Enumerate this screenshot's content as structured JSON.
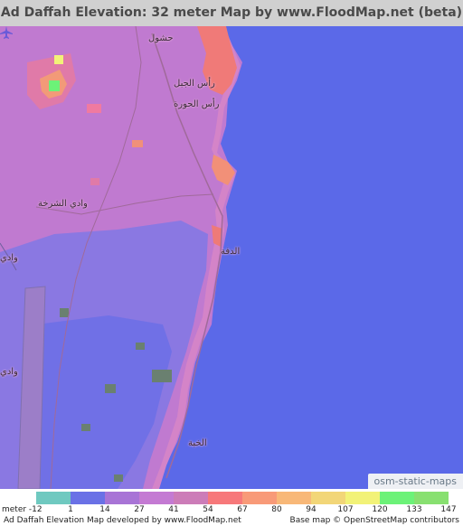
{
  "title": "Ad Daffah Elevation: 32 meter Map by www.FloodMap.net (beta)",
  "map": {
    "places": [
      {
        "name": "place-hashul",
        "label": "حشول"
      },
      {
        "name": "place-ras-al-jabal",
        "label": "رأس الجبل"
      },
      {
        "name": "place-ras-al-hawra",
        "label": "رأس الحورة"
      },
      {
        "name": "place-wadi-ash-sharkha",
        "label": "وادي الشرخة"
      },
      {
        "name": "place-ad-daffah",
        "label": "الدفة"
      },
      {
        "name": "place-wadi-left-1",
        "label": "وادي"
      },
      {
        "name": "place-wadi-left-2",
        "label": "وادي"
      },
      {
        "name": "place-al-khabbah",
        "label": "الخبة"
      }
    ],
    "osm_badge": "osm-static-maps",
    "airport_icon": "airplane-icon"
  },
  "legend": {
    "unit_label": "meter",
    "values": [
      "-12",
      "1",
      "14",
      "27",
      "41",
      "54",
      "67",
      "80",
      "94",
      "107",
      "120",
      "133",
      "147"
    ],
    "colors": [
      "#6fc9c0",
      "#6a71e6",
      "#a874d6",
      "#c47ad3",
      "#cc7cb8",
      "#f7787a",
      "#f89a78",
      "#f8b878",
      "#f2d678",
      "#f2f278",
      "#6cf278",
      "#88e070"
    ]
  },
  "footer": {
    "left": "Ad Daffah Elevation Map developed by www.FloodMap.net",
    "right": "Base map © OpenStreetMap contributors"
  }
}
